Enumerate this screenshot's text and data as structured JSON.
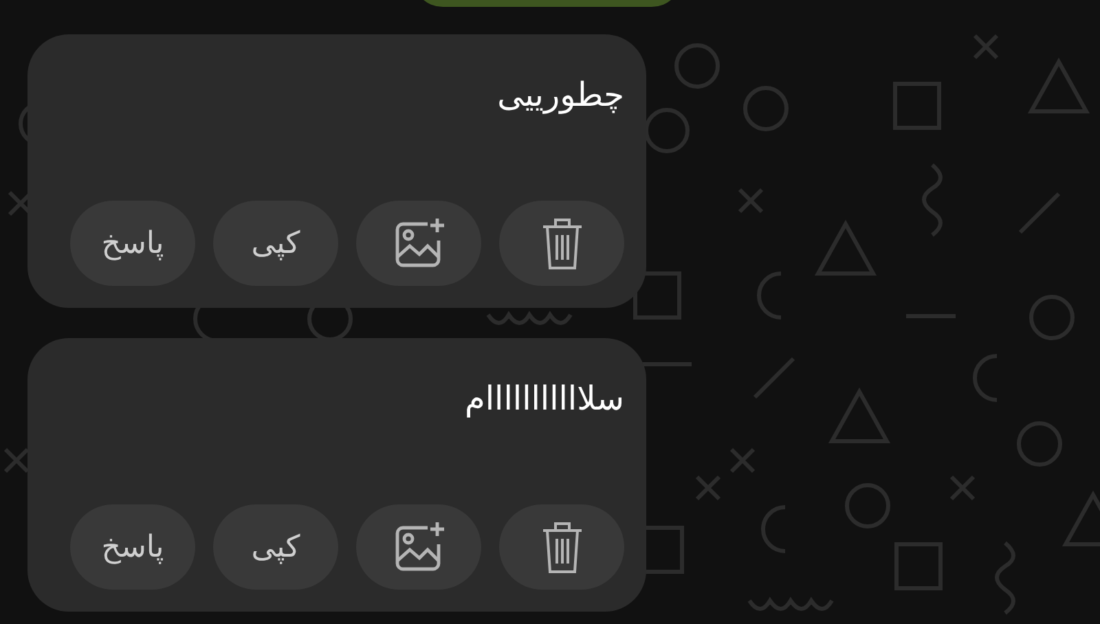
{
  "messages": [
    {
      "text": "چطورییی",
      "actions": [
        {
          "kind": "delete"
        },
        {
          "kind": "add_image"
        },
        {
          "kind": "text",
          "label": "کپی"
        },
        {
          "kind": "text",
          "label": "پاسخ"
        }
      ]
    },
    {
      "text": "سلااااااااااام",
      "actions": [
        {
          "kind": "delete"
        },
        {
          "kind": "add_image"
        },
        {
          "kind": "text",
          "label": "کپی"
        },
        {
          "kind": "text",
          "label": "پاسخ"
        }
      ]
    }
  ]
}
